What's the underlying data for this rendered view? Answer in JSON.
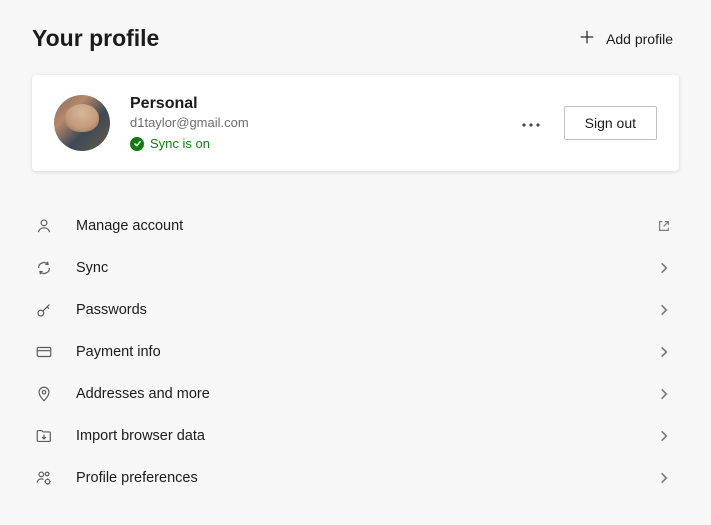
{
  "header": {
    "title": "Your profile",
    "add_profile_label": "Add profile"
  },
  "profile": {
    "name": "Personal",
    "email": "d1taylor@gmail.com",
    "sync_status_text": "Sync is on",
    "sign_out_label": "Sign out"
  },
  "settings": {
    "items": [
      {
        "label": "Manage account",
        "trailing": "external"
      },
      {
        "label": "Sync",
        "trailing": "chevron"
      },
      {
        "label": "Passwords",
        "trailing": "chevron"
      },
      {
        "label": "Payment info",
        "trailing": "chevron"
      },
      {
        "label": "Addresses and more",
        "trailing": "chevron"
      },
      {
        "label": "Import browser data",
        "trailing": "chevron"
      },
      {
        "label": "Profile preferences",
        "trailing": "chevron"
      }
    ]
  }
}
